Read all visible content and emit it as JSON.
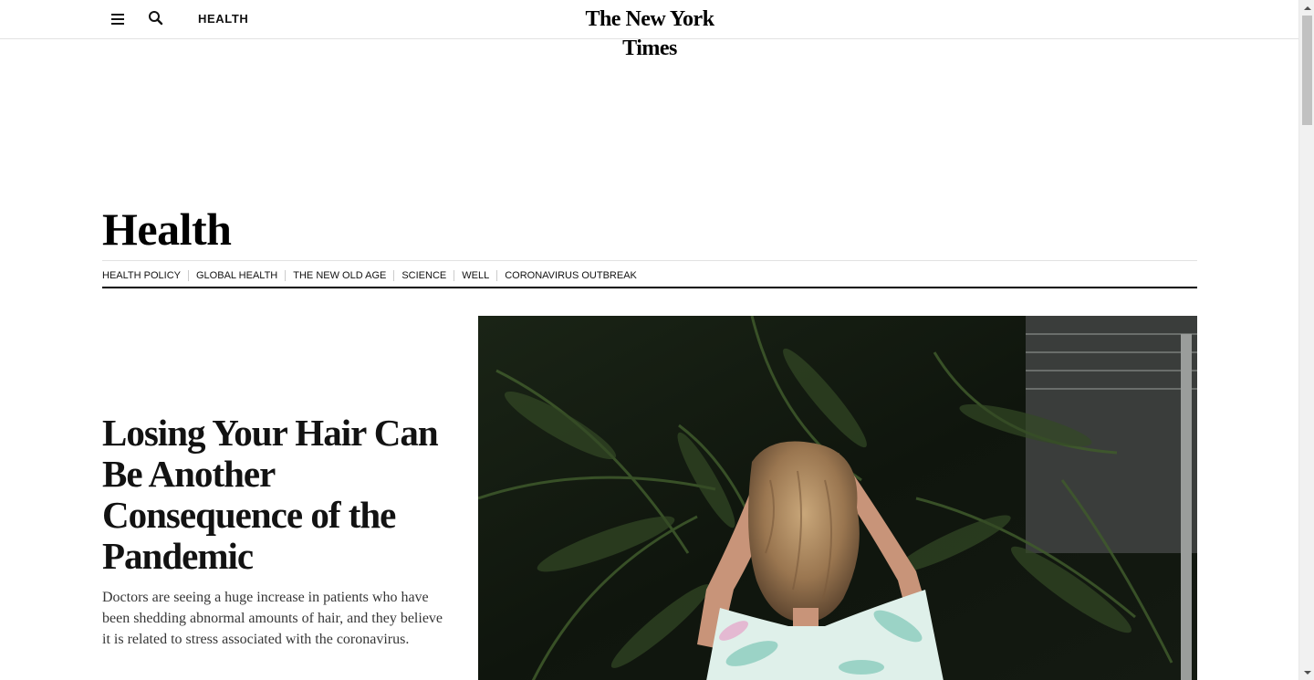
{
  "header": {
    "menu_icon": "hamburger-menu-icon",
    "search_icon": "search-icon",
    "section_label": "HEALTH",
    "logo_text": "The New York Times"
  },
  "section": {
    "title": "Health",
    "subnav": [
      {
        "label": "HEALTH POLICY"
      },
      {
        "label": "GLOBAL HEALTH"
      },
      {
        "label": "THE NEW OLD AGE"
      },
      {
        "label": "SCIENCE"
      },
      {
        "label": "WELL"
      },
      {
        "label": "CORONAVIRUS OUTBREAK"
      }
    ]
  },
  "lead_story": {
    "headline": "Losing Your Hair Can Be Another Consequence of the Pandemic",
    "summary": "Doctors are seeing a huge increase in patients who have been shedding abnormal amounts of hair, and they believe it is related to stress associated with the coronavirus."
  },
  "colors": {
    "text": "#121212",
    "rule": "#000000",
    "divider": "#e2e2e2",
    "photo_foliage": "#2e3d25"
  }
}
